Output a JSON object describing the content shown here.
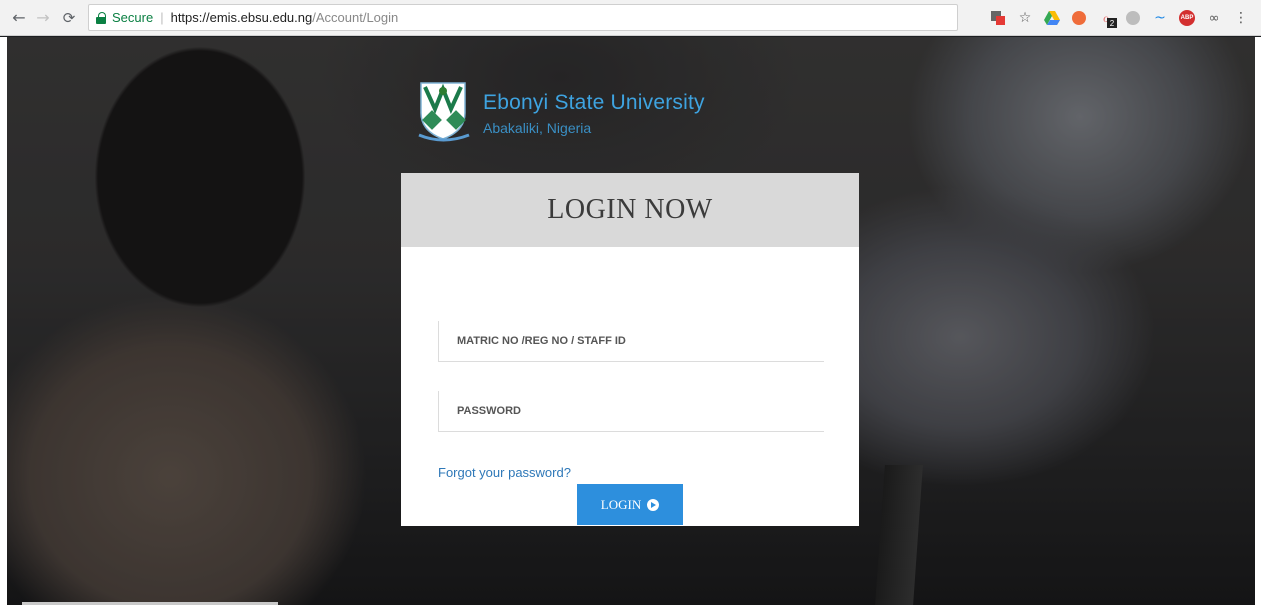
{
  "browser": {
    "security_label": "Secure",
    "url_host": "https://emis.ebsu.edu.ng",
    "url_path": "/Account/Login",
    "extension_badge": "2",
    "abp_label": "ABP"
  },
  "brand": {
    "name": "Ebonyi State University",
    "location": "Abakaliki, Nigeria"
  },
  "login": {
    "title": "LOGIN NOW",
    "username_placeholder": "MATRIC NO /REG NO / STAFF ID",
    "password_placeholder": "PASSWORD",
    "forgot_link": "Forgot your password?",
    "submit_label": "LOGIN"
  },
  "colors": {
    "brand_blue": "#3ea3e0",
    "button_blue": "#2d8fdd",
    "link_blue": "#2e78b8",
    "secure_green": "#0b8043"
  },
  "icons": [
    "back-arrow-icon",
    "forward-arrow-icon",
    "reload-icon",
    "lock-icon",
    "translate-icon",
    "star-icon",
    "google-drive-icon",
    "extension-icon",
    "abp-icon",
    "menu-icon",
    "arrow-circle-icon"
  ]
}
